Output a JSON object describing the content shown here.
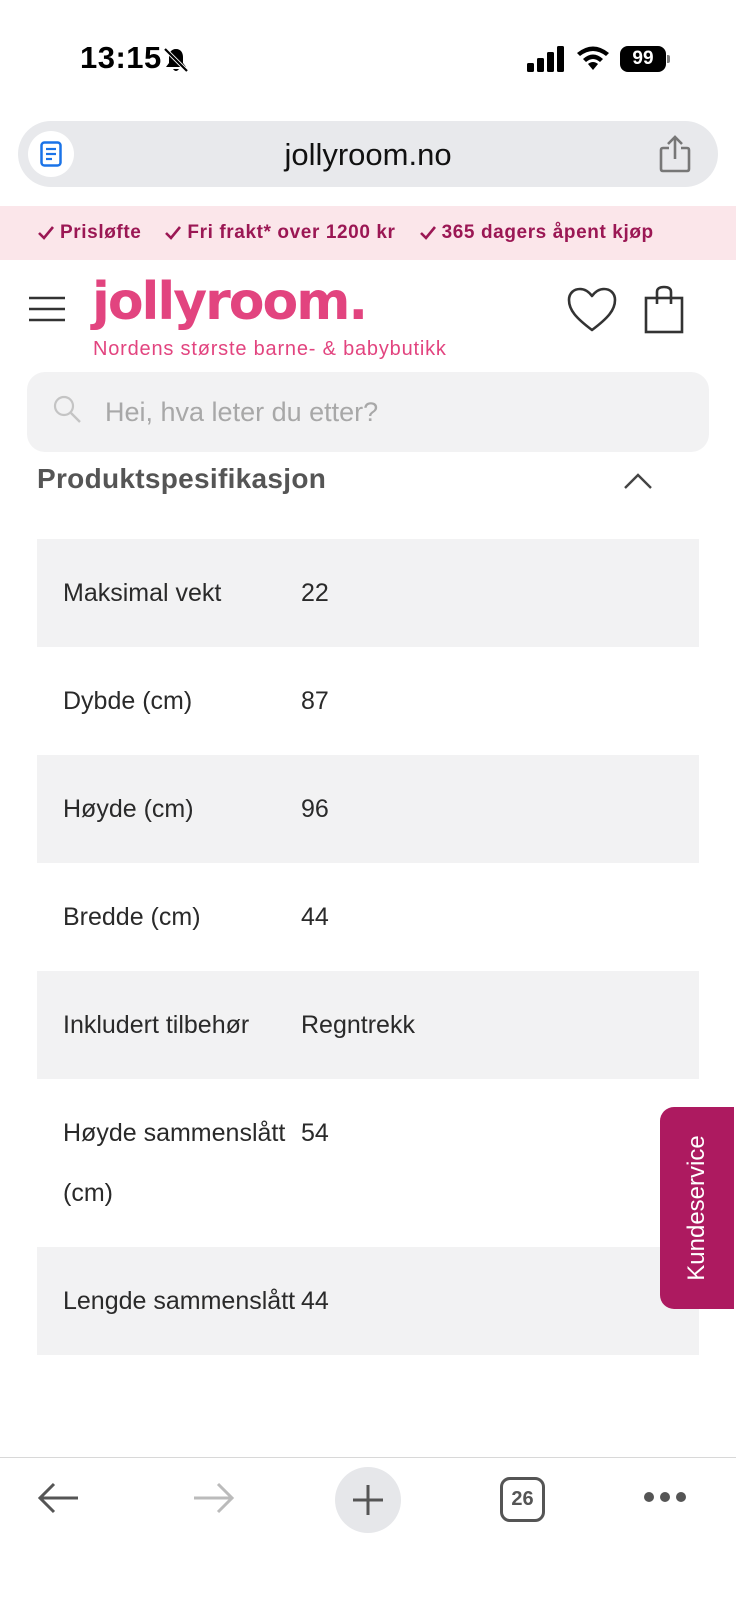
{
  "status_bar": {
    "time": "13:15",
    "battery": "99"
  },
  "browser": {
    "url": "jollyroom.no",
    "open_tabs": "26"
  },
  "promo": {
    "items": [
      "Prisløfte",
      "Fri frakt* over 1200 kr",
      "365 dagers åpent kjøp"
    ]
  },
  "header": {
    "logo": "jollyroom.",
    "tagline": "Nordens største barne- & babybutikk"
  },
  "search": {
    "placeholder": "Hei, hva leter du etter?"
  },
  "spec": {
    "title": "Produktspesifikasjon",
    "rows": [
      {
        "label": "Maksimal vekt",
        "value": "22"
      },
      {
        "label": "Dybde (cm)",
        "value": "87"
      },
      {
        "label": "Høyde (cm)",
        "value": "96"
      },
      {
        "label": "Bredde (cm)",
        "value": "44"
      },
      {
        "label": "Inkludert tilbehør",
        "value": "Regntrekk"
      },
      {
        "label": "Høyde sammenslått (cm)",
        "value": "54"
      },
      {
        "label": "Lengde sammenslått",
        "value": "44"
      }
    ]
  },
  "support": {
    "label": "Kundeservice"
  },
  "colors": {
    "brand_pink": "#e2447f",
    "promo_text": "#9b1754",
    "support_bg": "#ad1a60"
  }
}
